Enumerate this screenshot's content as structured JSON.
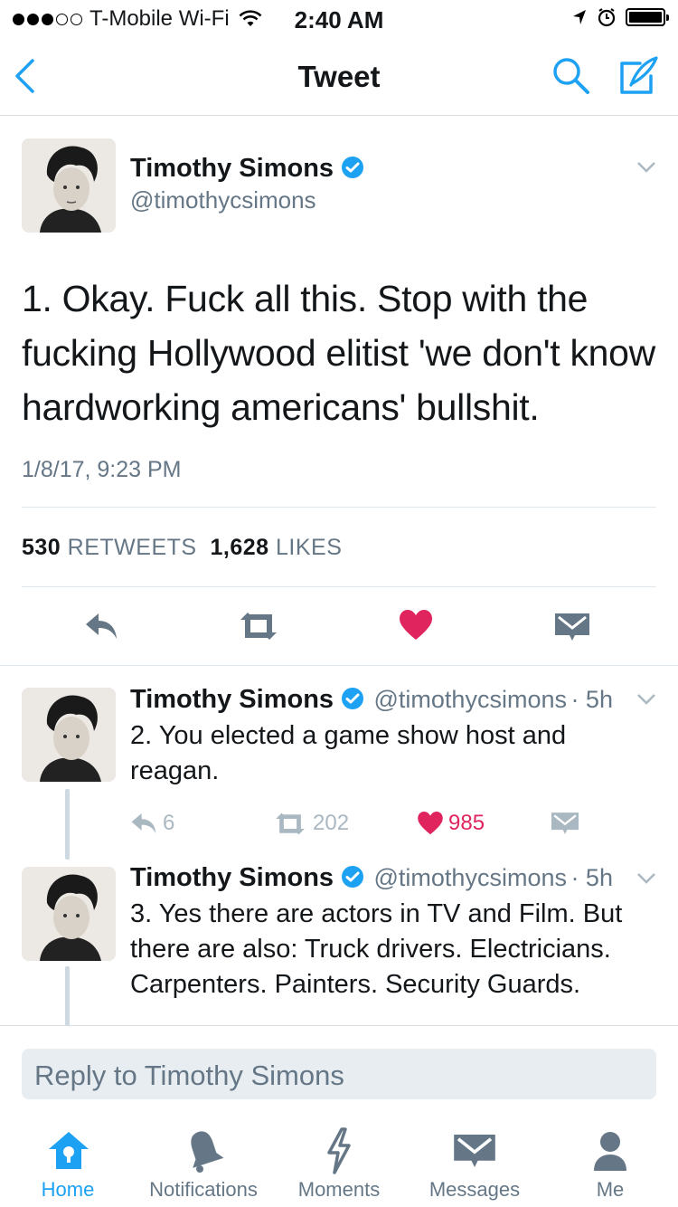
{
  "status_bar": {
    "carrier": "T-Mobile Wi-Fi",
    "time": "2:40 AM"
  },
  "nav": {
    "title": "Tweet",
    "back_icon": "chevron-left-icon",
    "search_icon": "search-icon",
    "compose_icon": "compose-icon"
  },
  "colors": {
    "accent": "#1da1f2",
    "like": "#e0245e",
    "muted": "#657786",
    "text": "#14171a"
  },
  "main_tweet": {
    "name": "Timothy Simons",
    "handle": "@timothycsimons",
    "text": "1.  Okay.  Fuck all this.  Stop with the fucking Hollywood elitist 'we don't know hardworking americans' bullshit.",
    "timestamp": "1/8/17, 9:23 PM",
    "retweets_count": "530",
    "retweets_label": "RETWEETS",
    "likes_count": "1,628",
    "likes_label": "LIKES"
  },
  "replies": [
    {
      "name": "Timothy Simons",
      "handle": "@timothycsimons",
      "time": "· 5h",
      "text": "2.  You elected a game show host and reagan.",
      "reply_count": "6",
      "retweet_count": "202",
      "like_count": "985"
    },
    {
      "name": "Timothy Simons",
      "handle": "@timothycsimons",
      "time": "· 5h",
      "text": "3.  Yes there are actors in TV and Film. But there are also:  Truck drivers. Electricians.  Carpenters.  Painters. Security Guards."
    }
  ],
  "compose": {
    "placeholder": "Reply to Timothy Simons"
  },
  "tabs": [
    {
      "label": "Home",
      "icon": "home-icon",
      "active": true
    },
    {
      "label": "Notifications",
      "icon": "bell-icon"
    },
    {
      "label": "Moments",
      "icon": "lightning-icon"
    },
    {
      "label": "Messages",
      "icon": "envelope-icon"
    },
    {
      "label": "Me",
      "icon": "person-icon"
    }
  ]
}
